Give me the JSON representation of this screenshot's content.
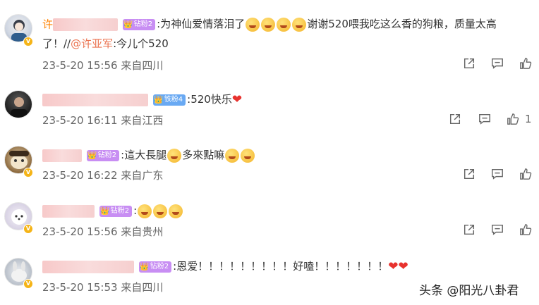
{
  "comments": [
    {
      "name_prefix": "许",
      "badge": "钻粉2",
      "line1": ":为神仙爱情落泪了",
      "line1_after": "谢谢520喂我吃这么香的狗粮，质量太高",
      "line2_pre": "了！//",
      "mention": "@许亚军",
      "line2_post": ":今儿个520",
      "date": "23-5-20 15:56",
      "location": "来自四川",
      "likes": ""
    },
    {
      "badge": "铁粉4",
      "text": ":520快乐",
      "date": "23-5-20 16:11",
      "location": "来自江西",
      "likes": "1"
    },
    {
      "badge": "钻粉2",
      "text_pre": ":這大長腿",
      "text_mid": "多來點嘛",
      "date": "23-5-20 16:22",
      "location": "来自广东",
      "likes": ""
    },
    {
      "badge": "钻粉2",
      "text": ":",
      "date": "23-5-20 15:56",
      "location": "来自贵州",
      "likes": ""
    },
    {
      "badge": "钻粉2",
      "text": ":恩爱！！！！！！！！！好嗑！！！！！！！",
      "date": "23-5-20 15:53",
      "location": "来自四川",
      "likes": ""
    }
  ],
  "watermark": "头条 @阳光八卦君",
  "colors": {
    "accent": "#ff8200",
    "mention": "#eb7350",
    "fan_pink": "#c88ef3",
    "fan_blue": "#69a9f3",
    "heart": "#e8322e"
  },
  "icons": [
    "share-icon",
    "comment-icon",
    "like-icon",
    "verified-v-icon",
    "crown-icon"
  ]
}
